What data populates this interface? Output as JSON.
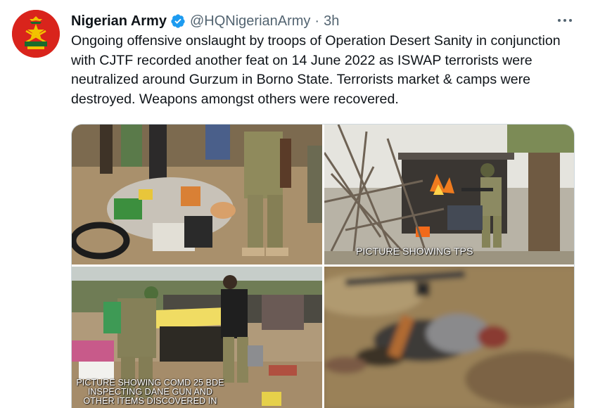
{
  "user": {
    "display_name": "Nigerian Army",
    "handle": "@HQNigerianArmy",
    "separator": "·",
    "timestamp": "3h",
    "verified": true,
    "avatar_icon": "army-crest-icon"
  },
  "tweet": {
    "text": "Ongoing offensive onslaught by troops of Operation Desert Sanity in conjunction with CJTF recorded another feat on 14 June 2022 as ISWAP terrorists were neutralized around Gurzum in Borno State. Terrorists market & camps were destroyed. Weapons amongst others were recovered."
  },
  "media": {
    "captions": {
      "top_right": "PICTURE SHOWING TPS",
      "bottom_left": "PICTURE SHOWING COMD 25 BDE INSPECTING DANE GUN AND OTHER ITEMS DISCOVERED IN"
    }
  },
  "colors": {
    "text": "#0f1419",
    "secondary": "#536471",
    "verified": "#1d9bf0",
    "avatar_bg": "#d9241c",
    "border": "#cfd9de"
  }
}
